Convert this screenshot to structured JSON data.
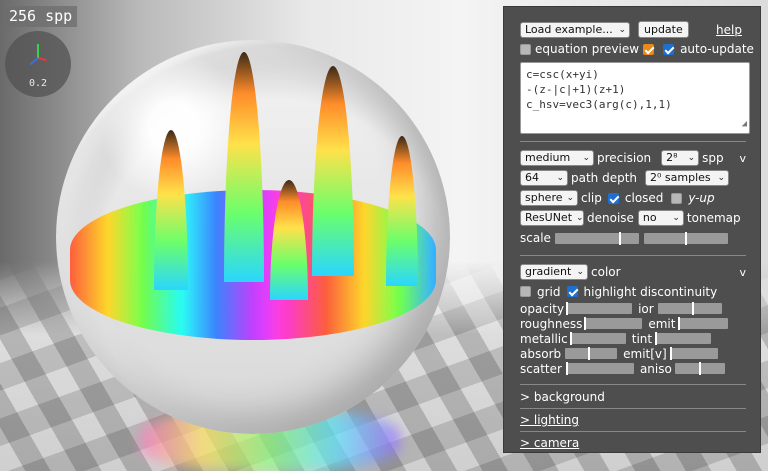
{
  "overlay": {
    "spp_counter": "256 spp",
    "axis_value": "0.2"
  },
  "panel": {
    "top": {
      "load_example": "Load example...",
      "update": "update",
      "help": "help",
      "equation_preview": "equation preview",
      "equation_preview_checked": true,
      "auto_update": "auto-update",
      "auto_update_checked": true,
      "equation_lines": [
        "c=csc(x+yi)",
        "-(z-|c|+1)(z+1)",
        "c_hsv=vec3(arg(c),1,1)"
      ]
    },
    "render": {
      "quality": "medium",
      "precision_label": "precision",
      "spp_select": "2⁸",
      "spp_label": "spp",
      "collapse": "v",
      "path_depth_select": "64",
      "path_depth_label": "path depth",
      "samples_select": "2⁰ samples",
      "clip_select": "sphere",
      "clip_label": "clip",
      "closed_label": "closed",
      "closed_checked": true,
      "y_up_label": "y-up",
      "y_up_checked": false,
      "denoise_select": "ResUNet",
      "denoise_label": "denoise",
      "tonemap_select": "no",
      "tonemap_label": "tonemap",
      "scale_label": "scale",
      "scale_value_1": 0.78,
      "scale_value_2": 0.5
    },
    "material": {
      "color_select": "gradient",
      "color_label": "color",
      "collapse": "v",
      "grid_label": "grid",
      "grid_checked": false,
      "highlight_label": "highlight discontinuity",
      "highlight_checked": true,
      "opacity_label": "opacity",
      "opacity_value": 0.0,
      "ior_label": "ior",
      "ior_value": 0.55,
      "roughness_label": "roughness",
      "roughness_value": 0.0,
      "emit_label": "emit",
      "emit_value": 0.0,
      "metallic_label": "metallic",
      "metallic_value": 0.0,
      "tint_label": "tint",
      "tint_value": 0.0,
      "absorb_label": "absorb",
      "absorb_value": 0.45,
      "emit_v_label": "emit[v]",
      "emit_v_value": 0.0,
      "scatter_label": "scatter",
      "scatter_value": 0.0,
      "aniso_label": "aniso",
      "aniso_value": 0.5
    },
    "sections": {
      "background": "> background",
      "lighting": "> lighting",
      "camera": "> camera"
    }
  },
  "colors": {
    "panel_bg": "#4e4e4e",
    "checkbox_blue": "#1f6fd1",
    "checkbox_orange": "#e8891b",
    "axis_x": "#e23b3b",
    "axis_y": "#3bd14b",
    "axis_z": "#3b6ee2"
  },
  "icons": {
    "axes_gizmo": "xyz-axes-icon",
    "select_arrow": "chevron-down-icon",
    "resize_grip": "resize-grip-icon"
  }
}
